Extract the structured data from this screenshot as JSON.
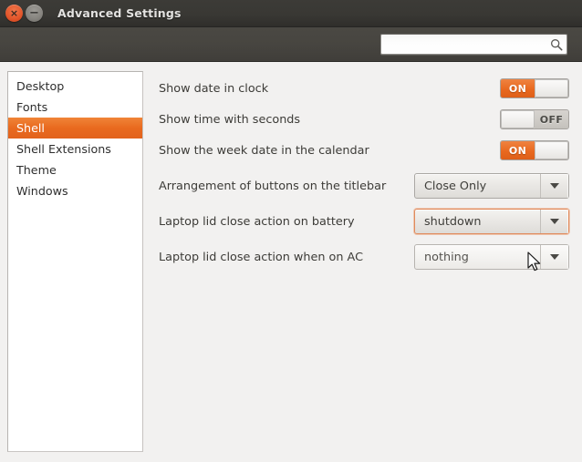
{
  "window": {
    "title": "Advanced Settings",
    "close_button": "×",
    "minimize_button": "−"
  },
  "toolbar": {
    "search": {
      "value": "",
      "placeholder": "",
      "icon": "search-icon"
    }
  },
  "sidebar": {
    "items": [
      {
        "label": "Desktop",
        "selected": false
      },
      {
        "label": "Fonts",
        "selected": false
      },
      {
        "label": "Shell",
        "selected": true
      },
      {
        "label": "Shell Extensions",
        "selected": false
      },
      {
        "label": "Theme",
        "selected": false
      },
      {
        "label": "Windows",
        "selected": false
      }
    ]
  },
  "settings": {
    "rows": [
      {
        "label": "Show date in clock",
        "control": "switch",
        "state": "ON",
        "on_label": "ON",
        "off_label": "OFF"
      },
      {
        "label": "Show time with seconds",
        "control": "switch",
        "state": "OFF",
        "on_label": "ON",
        "off_label": "OFF"
      },
      {
        "label": "Show the week date in the calendar",
        "control": "switch",
        "state": "ON",
        "on_label": "ON",
        "off_label": "OFF"
      },
      {
        "label": "Arrangement of buttons on the titlebar",
        "control": "combo",
        "value": "Close Only",
        "focused": false,
        "hovered": false
      },
      {
        "label": "Laptop lid close action on battery",
        "control": "combo",
        "value": "shutdown",
        "focused": true,
        "hovered": false
      },
      {
        "label": "Laptop lid close action when on AC",
        "control": "combo",
        "value": "nothing",
        "focused": false,
        "hovered": true
      }
    ]
  },
  "colors": {
    "accent_orange": "#e9691f",
    "titlebar_dark": "#3a3935",
    "toolbar_dark": "#474540",
    "content_bg": "#f2f1f0",
    "sidebar_bg": "#ffffff",
    "focus_border": "#e08a5c"
  }
}
